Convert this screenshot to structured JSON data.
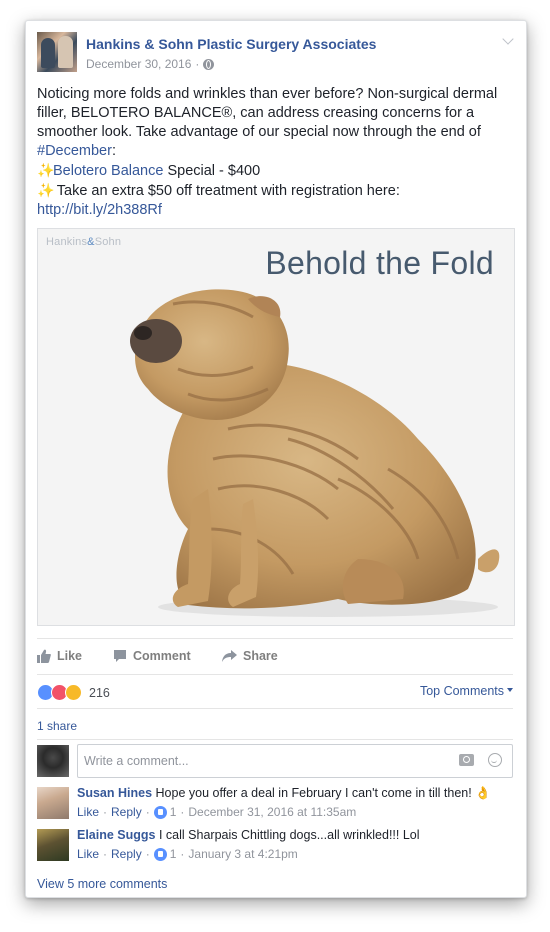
{
  "post": {
    "page_name": "Hankins & Sohn Plastic Surgery Associates",
    "date": "December 30, 2016",
    "dot": "·",
    "privacy_icon": "globe-icon",
    "text_line1": "Noticing more folds and wrinkles than ever before? Non-surgical dermal filler, BELOTERO BALANCE®, can address creasing concerns for a smoother look. Take advantage of our special now through the end of",
    "hashtag": "#December",
    "hashtag_suffix": ":",
    "sparkle": "✨",
    "special_link": "Belotero Balance",
    "special_text": " Special - $400",
    "extra_text": " Take an extra $50 off treatment with registration here:",
    "url": "http://bit.ly/2h388Rf"
  },
  "photo": {
    "brand_a": "Hankins",
    "brand_amp": "&",
    "brand_b": "Sohn",
    "title": "Behold the Fold"
  },
  "actions": {
    "like": "Like",
    "comment": "Comment",
    "share": "Share"
  },
  "reactions": {
    "count": "216",
    "top_comments": "Top Comments"
  },
  "shares": "1 share",
  "comment_input": {
    "placeholder": "Write a comment..."
  },
  "comments": [
    {
      "name": "Susan Hines",
      "text": "Hope you offer a deal in February I can't come in till then!",
      "emoji": "👌",
      "like": "Like",
      "reply": "Reply",
      "likes": "1",
      "time": "December 31, 2016 at 11:35am"
    },
    {
      "name": "Elaine Suggs",
      "text": "I call Sharpais Chittling dogs...all wrinkled!!! Lol",
      "like": "Like",
      "reply": "Reply",
      "likes": "1",
      "time": "January 3 at 4:21pm"
    }
  ],
  "more_comments": "View 5 more comments",
  "colors": {
    "link": "#365899",
    "like_blue": "#5890ff",
    "love_red": "#f25268",
    "haha_yellow": "#f7b928"
  }
}
